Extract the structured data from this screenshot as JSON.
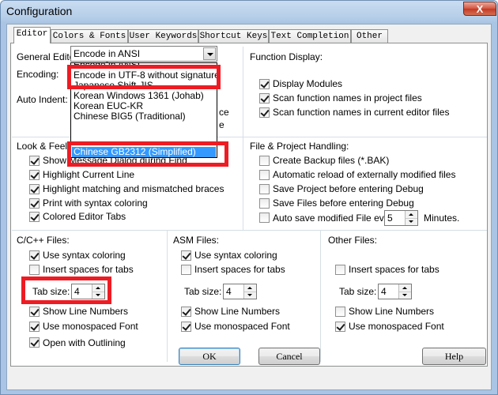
{
  "window": {
    "title": "Configuration",
    "close_label": "X"
  },
  "tabs": [
    "Editor",
    "Colors & Fonts",
    "User Keywords",
    "Shortcut Keys",
    "Text Completion",
    "Other"
  ],
  "general": {
    "heading": "General Editor Settings:",
    "encoding_label": "Encoding:",
    "encoding_value": "Encode in ANSI",
    "auto_indent_label": "Auto Indent:",
    "partial_right_1": "ce",
    "partial_right_2": "e",
    "dropdown_options": [
      "Encode in ANSI",
      "Encode in UTF-8 without signature",
      "Japanese Shift-JIS",
      "Korean Windows 1361 (Johab)",
      "Korean EUC-KR",
      "Chinese BIG5 (Traditional)",
      "Chinese GB2312 (Simplified)"
    ]
  },
  "function_display": {
    "heading": "Function Display:",
    "options": [
      {
        "label": "Display Modules",
        "checked": true
      },
      {
        "label": "Scan function names in project files",
        "checked": true
      },
      {
        "label": "Scan function names in current editor files",
        "checked": true
      }
    ]
  },
  "look_feel": {
    "heading": "Look & Feel:",
    "options": [
      {
        "label": "Show Message Dialog during Find",
        "checked": true
      },
      {
        "label": "Highlight Current Line",
        "checked": true
      },
      {
        "label": "Highlight matching and mismatched braces",
        "checked": true
      },
      {
        "label": "Print with syntax coloring",
        "checked": true
      },
      {
        "label": "Colored Editor Tabs",
        "checked": true
      }
    ]
  },
  "file_project": {
    "heading": "File & Project Handling:",
    "options": [
      {
        "label": "Create Backup files (*.BAK)",
        "checked": false
      },
      {
        "label": "Automatic reload of externally modified files",
        "checked": false
      },
      {
        "label": "Save Project before entering Debug",
        "checked": false
      },
      {
        "label": "Save Files before entering Debug",
        "checked": false
      },
      {
        "label": "Auto save modified File every",
        "checked": false
      }
    ],
    "autosave_value": "5",
    "minutes_label": "Minutes."
  },
  "cpp_files": {
    "heading": "C/C++ Files:",
    "syntax": "Use syntax coloring",
    "spaces": "Insert spaces for tabs",
    "tab_label": "Tab size:",
    "tab_value": "4",
    "line_numbers": "Show Line Numbers",
    "mono": "Use monospaced Font",
    "outlining": "Open with Outlining"
  },
  "asm_files": {
    "heading": "ASM Files:",
    "syntax": "Use syntax coloring",
    "spaces": "Insert spaces for tabs",
    "tab_label": "Tab size:",
    "tab_value": "4",
    "line_numbers": "Show Line Numbers",
    "mono": "Use monospaced Font"
  },
  "other_files": {
    "heading": "Other Files:",
    "spaces": "Insert spaces for tabs",
    "tab_label": "Tab size:",
    "tab_value": "4",
    "line_numbers": "Show Line Numbers",
    "mono": "Use monospaced Font"
  },
  "buttons": {
    "ok": "OK",
    "cancel": "Cancel",
    "help": "Help"
  },
  "colors": {
    "highlight": "#ed1c24",
    "selection": "#3399ff"
  }
}
